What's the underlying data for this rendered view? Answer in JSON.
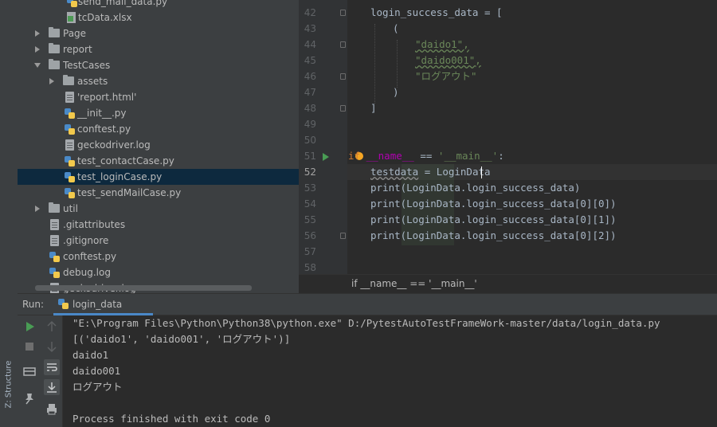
{
  "left_strip": {
    "structure_label": "Z: Structure"
  },
  "tree": {
    "items": [
      {
        "label": "send_mail_data.py",
        "icon": "python-file-icon"
      },
      {
        "label": "tcData.xlsx",
        "icon": "excel-file-icon"
      },
      {
        "label": "Page",
        "icon": "folder-icon"
      },
      {
        "label": "report",
        "icon": "folder-icon"
      },
      {
        "label": "TestCases",
        "icon": "folder-icon"
      },
      {
        "label": "assets",
        "icon": "folder-icon"
      },
      {
        "label": "'report.html'",
        "icon": "text-file-icon"
      },
      {
        "label": "__init__.py",
        "icon": "python-file-icon"
      },
      {
        "label": "conftest.py",
        "icon": "python-file-icon"
      },
      {
        "label": "geckodriver.log",
        "icon": "text-file-icon"
      },
      {
        "label": "test_contactCase.py",
        "icon": "python-file-icon"
      },
      {
        "label": "test_loginCase.py",
        "icon": "python-file-icon",
        "selected": true
      },
      {
        "label": "test_sendMailCase.py",
        "icon": "python-file-icon"
      },
      {
        "label": "util",
        "icon": "folder-icon"
      },
      {
        "label": ".gitattributes",
        "icon": "text-file-icon"
      },
      {
        "label": ".gitignore",
        "icon": "text-file-icon"
      },
      {
        "label": "conftest.py",
        "icon": "python-file-icon"
      },
      {
        "label": "debug.log",
        "icon": "text-file-icon"
      },
      {
        "label": "geckodriver.log",
        "icon": "text-file-icon"
      }
    ]
  },
  "editor": {
    "line_numbers": [
      "42",
      "43",
      "44",
      "45",
      "46",
      "47",
      "48",
      "49",
      "50",
      "51",
      "52",
      "53",
      "54",
      "55",
      "56",
      "57",
      "58"
    ],
    "current_line": "52",
    "lines": {
      "l42": "login_success_data = [",
      "l43": "(",
      "l44": "\"daido1\",",
      "l45": "\"daido001\",",
      "l46": "\"ログアウト\"",
      "l47": ")",
      "l48": "]",
      "l51_kw": "if",
      "l51_dunder": "__name__",
      "l51_eq": " == ",
      "l51_str": "'__main__'",
      "l51_colon": ":",
      "l52_var": "testdata",
      "l52_rest": " = LoginData",
      "l53": "print(LoginData.login_success_data)",
      "l54": "print(LoginData.login_success_data[0][0])",
      "l55": "print(LoginData.login_success_data[0][1])",
      "l56": "print(LoginData.login_success_data[0][2])"
    },
    "breadcrumb": "if __name__ == '__main__'"
  },
  "run": {
    "title": "Run:",
    "tab_label": "login_data",
    "console_lines": [
      "\"E:\\Program Files\\Python\\Python38\\python.exe\" D:/PytestAutoTestFrameWork-master/data/login_data.py",
      "[('daido1', 'daido001', 'ログアウト')]",
      "daido1",
      "daido001",
      "ログアウト",
      "",
      "Process finished with exit code 0"
    ]
  },
  "colors": {
    "accent": "#4a88c7",
    "run_green": "#499c54",
    "string_green": "#6a8759",
    "keyword_orange": "#cc7832"
  }
}
